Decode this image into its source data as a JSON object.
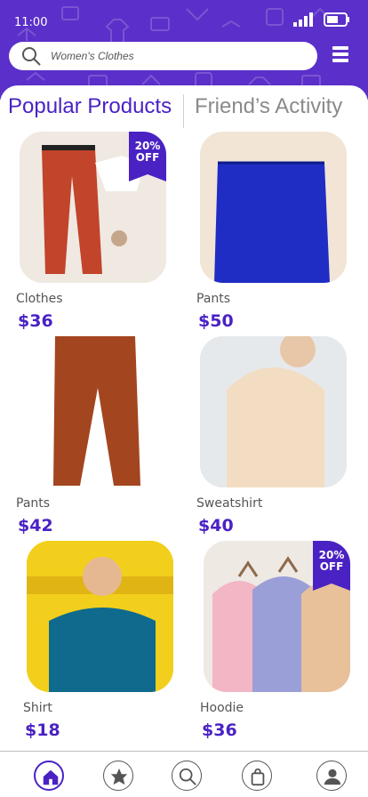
{
  "status_bar": {
    "time": "11:00"
  },
  "search": {
    "placeholder": "Women's Clothes"
  },
  "tabs": [
    {
      "label": "Popular Products",
      "active": true
    },
    {
      "label": "Friend’s Activity",
      "active": false
    }
  ],
  "products": [
    {
      "name": "Clothes",
      "price": "$36",
      "badge": [
        "20%",
        "OFF"
      ]
    },
    {
      "name": "Pants",
      "price": "$50"
    },
    {
      "name": "Pants",
      "price": "$42"
    },
    {
      "name": "Sweatshirt",
      "price": "$40"
    },
    {
      "name": "Shirt",
      "price": "$18"
    },
    {
      "name": "Hoodie",
      "price": "$36",
      "badge": [
        "20%",
        "OFF"
      ]
    }
  ],
  "bottom_nav": [
    {
      "icon": "home-icon",
      "active": true
    },
    {
      "icon": "star-icon",
      "active": false
    },
    {
      "icon": "search-icon",
      "active": false
    },
    {
      "icon": "shopping-bag-icon",
      "active": false
    },
    {
      "icon": "profile-icon",
      "active": false
    }
  ],
  "colors": {
    "brand": "#5b2fc9",
    "accent": "#4a22c4"
  }
}
